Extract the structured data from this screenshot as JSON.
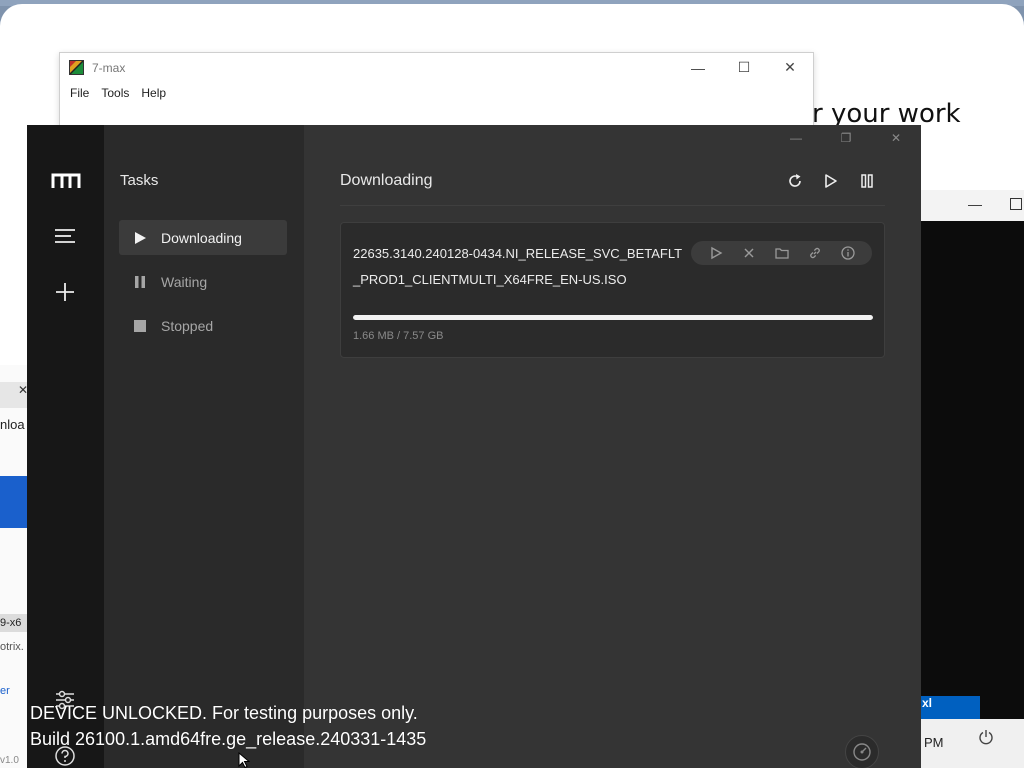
{
  "background_page": {
    "headline_fragment": "r your work"
  },
  "seven_max": {
    "title": "7-max",
    "menus": [
      "File",
      "Tools",
      "Help"
    ],
    "controls": {
      "minimize": "—",
      "maximize": "☐",
      "close": "✕"
    }
  },
  "right_window": {
    "button_label": "xl",
    "time_fragment": "PM"
  },
  "left_window": {
    "tab_close": "✕",
    "download_fragment": "nloa",
    "file_fragment": "9-x6",
    "otrix_fragment": "otrix.",
    "link_fragment": "er",
    "version_fragment": "v1.0"
  },
  "motrix": {
    "sidebar": {
      "title": "Tasks",
      "items": [
        {
          "label": "Downloading",
          "icon": "play-icon",
          "active": true
        },
        {
          "label": "Waiting",
          "icon": "pause-icon",
          "active": false
        },
        {
          "label": "Stopped",
          "icon": "stop-icon",
          "active": false
        }
      ]
    },
    "main": {
      "title": "Downloading",
      "tools": [
        "refresh-icon",
        "resume-all-icon",
        "pause-all-icon"
      ]
    },
    "task": {
      "name": "22635.3140.240128-0434.NI_RELEASE_SVC_BETAFLT_PROD1_CLIENTMULTI_X64FRE_EN-US.ISO",
      "size_text": "1.66 MB / 7.57 GB",
      "progress_fraction": 1.0,
      "actions": [
        "play-icon",
        "remove-icon",
        "folder-icon",
        "link-icon",
        "info-icon"
      ]
    },
    "colors": {
      "accent": "#f2f2f2",
      "rail": "#171717",
      "sidebar": "#2a2a2a",
      "main": "#343434"
    }
  },
  "watermark": {
    "line1": "DEVICE UNLOCKED. For testing purposes only.",
    "line2": "Build 26100.1.amd64fre.ge_release.240331-1435"
  }
}
